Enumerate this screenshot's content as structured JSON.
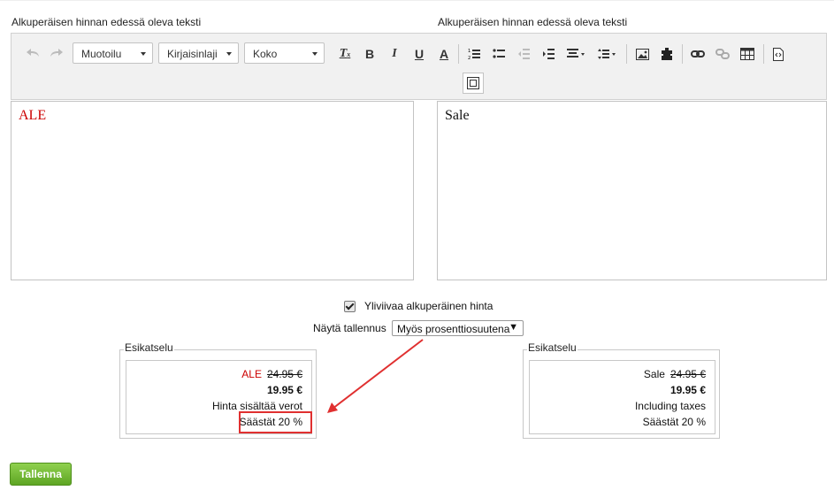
{
  "labels": {
    "left_field": "Alkuperäisen hinnan edessä oleva teksti",
    "right_field": "Alkuperäisen hinnan edessä oleva teksti"
  },
  "toolbar": {
    "format_combo": "Muotoilu",
    "font_combo": "Kirjaisinlaji",
    "size_combo": "Koko",
    "bold": "B",
    "italic": "I",
    "underline": "U",
    "text_color": "A",
    "icons": [
      "undo-icon",
      "redo-icon",
      "remove-format-icon",
      "bold-icon",
      "italic-icon",
      "underline-icon",
      "text-color-icon",
      "numbered-list-icon",
      "bulleted-list-icon",
      "decrease-indent-icon",
      "increase-indent-icon",
      "align-icon",
      "line-height-icon",
      "image-icon",
      "plugin-icon",
      "link-icon",
      "unlink-icon",
      "table-icon",
      "source-icon",
      "show-blocks-icon"
    ]
  },
  "editors": {
    "left_text": "ALE",
    "right_text": "Sale",
    "left_color": "#cc0000"
  },
  "options": {
    "strike_label": "Yliviivaa alkuperäinen hinta",
    "strike_checked": true,
    "show_savings_label": "Näytä tallennus",
    "show_savings_value": "Myös prosenttiosuutena"
  },
  "preview_left": {
    "legend": "Esikatselu",
    "prefix": "ALE",
    "original_price": "24.95 €",
    "price": "19.95 €",
    "tax_text": "Hinta sisältää verot",
    "savings": "Säästät 20 %"
  },
  "preview_right": {
    "legend": "Esikatselu",
    "prefix": "Sale",
    "original_price": "24.95 €",
    "price": "19.95 €",
    "tax_text": "Including taxes",
    "savings": "Säästät 20 %"
  },
  "annotation": {
    "arrow_color": "#e03030",
    "highlight_color": "#e03030"
  },
  "actions": {
    "save_label": "Tallenna"
  }
}
